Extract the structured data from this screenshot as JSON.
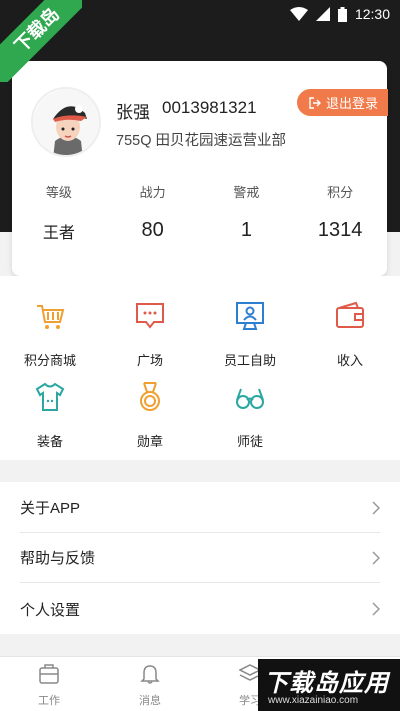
{
  "status_bar": {
    "time": "12:30"
  },
  "watermark_top": "下载岛",
  "profile": {
    "name": "张强",
    "employee_id": "0013981321",
    "department": "755Q  田贝花园速运营业部",
    "logout_label": "退出登录"
  },
  "stats": [
    {
      "label": "等级",
      "value": "王者"
    },
    {
      "label": "战力",
      "value": "80"
    },
    {
      "label": "警戒",
      "value": "1"
    },
    {
      "label": "积分",
      "value": "1314"
    }
  ],
  "grid": [
    {
      "label": "积分商城",
      "icon": "cart-icon",
      "color": "#f0a030"
    },
    {
      "label": "广场",
      "icon": "chat-bubble-icon",
      "color": "#e05a4a"
    },
    {
      "label": "员工自助",
      "icon": "monitor-user-icon",
      "color": "#2f7fd0"
    },
    {
      "label": "收入",
      "icon": "wallet-icon",
      "color": "#e05a4a"
    },
    {
      "label": "装备",
      "icon": "tshirt-icon",
      "color": "#2aa7a0"
    },
    {
      "label": "勋章",
      "icon": "medal-icon",
      "color": "#f0a030"
    },
    {
      "label": "师徒",
      "icon": "glasses-icon",
      "color": "#2aa7a0"
    }
  ],
  "menu": [
    {
      "label": "关于APP"
    },
    {
      "label": "帮助与反馈"
    },
    {
      "label": "个人设置"
    }
  ],
  "tabs": [
    {
      "label": "工作",
      "icon": "briefcase-icon"
    },
    {
      "label": "消息",
      "icon": "bell-icon"
    },
    {
      "label": "学习",
      "icon": "layers-icon"
    }
  ],
  "watermark_bottom": {
    "title": "下载岛应用",
    "url": "www.xiazainiao.com"
  }
}
